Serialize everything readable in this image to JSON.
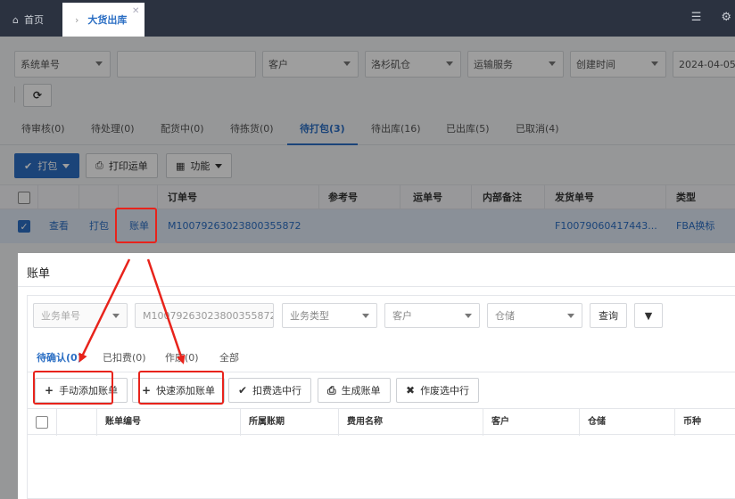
{
  "topbar": {
    "home_label": "首页",
    "active_tab_label": "大货出库",
    "close_glyph": "✕"
  },
  "filters": {
    "field1": "系统单号",
    "field2": "",
    "field3": "客户",
    "field4": "洛杉矶仓",
    "field5": "运输服务",
    "field6": "创建时间",
    "field7": "2024-04-05"
  },
  "status_tabs": [
    {
      "label": "待审核(0)"
    },
    {
      "label": "待处理(0)"
    },
    {
      "label": "配货中(0)"
    },
    {
      "label": "待拣货(0)"
    },
    {
      "label": "待打包(3)"
    },
    {
      "label": "待出库(16)"
    },
    {
      "label": "已出库(5)"
    },
    {
      "label": "已取消(4)"
    }
  ],
  "actions": {
    "pack": "打包",
    "print": "打印运单",
    "functions": "功能"
  },
  "table": {
    "headers": [
      "订单号",
      "参考号",
      "运单号",
      "内部备注",
      "发货单号",
      "类型"
    ],
    "row": {
      "view": "查看",
      "pack": "打包",
      "bill": "账单",
      "order_no": "M10079263023800355872",
      "shipment_no": "F10079060417443...",
      "type": "FBA换标"
    }
  },
  "modal": {
    "title": "账单",
    "filters": {
      "business_no": "业务单号",
      "order_value": "M10079263023800355872",
      "business_type": "业务类型",
      "customer": "客户",
      "warehouse": "仓储",
      "query": "查询"
    },
    "tabs": [
      {
        "label": "待确认(0)"
      },
      {
        "label": "已扣费(0)"
      },
      {
        "label": "作废(0)"
      },
      {
        "label": "全部"
      }
    ],
    "buttons": {
      "manual_add": "手动添加账单",
      "quick_add": "快速添加账单",
      "deduct": "扣费选中行",
      "generate": "生成账单",
      "void": "作废选中行"
    },
    "headers": [
      "账单编号",
      "所属账期",
      "费用名称",
      "客户",
      "仓储",
      "币种"
    ]
  },
  "colors": {
    "accent": "#2c6fc4",
    "annotation": "#e8231b",
    "topbar": "#2b3240"
  }
}
